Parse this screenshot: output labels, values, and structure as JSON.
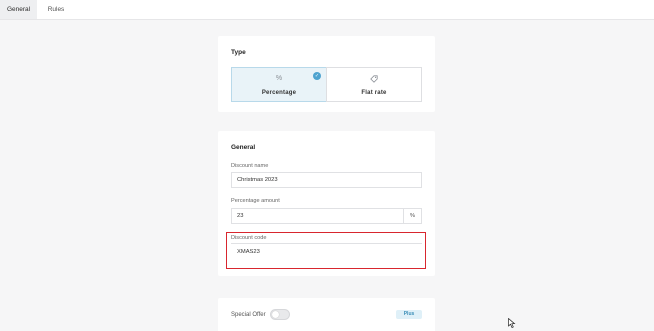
{
  "tabs": [
    {
      "label": "General",
      "active": true
    },
    {
      "label": "Rules",
      "active": false
    }
  ],
  "type_section": {
    "title": "Type",
    "options": [
      {
        "label": "Percentage",
        "icon": "percent-icon",
        "glyph": "%",
        "selected": true
      },
      {
        "label": "Flat rate",
        "icon": "tag-icon",
        "glyph": "◇",
        "selected": false
      }
    ]
  },
  "general_section": {
    "title": "General",
    "discount_name": {
      "label": "Discount name",
      "value": "Christmas 2023"
    },
    "percentage_amount": {
      "label": "Percentage amount",
      "value": "23",
      "suffix": "%"
    },
    "discount_code": {
      "label": "Discount code",
      "value": "XMAS23"
    }
  },
  "special_offer": {
    "label": "Special Offer",
    "enabled": false,
    "badge": "Plus"
  },
  "colors": {
    "accent": "#4ea3cf",
    "highlight": "#d8262e",
    "background": "#f6f6f7"
  }
}
